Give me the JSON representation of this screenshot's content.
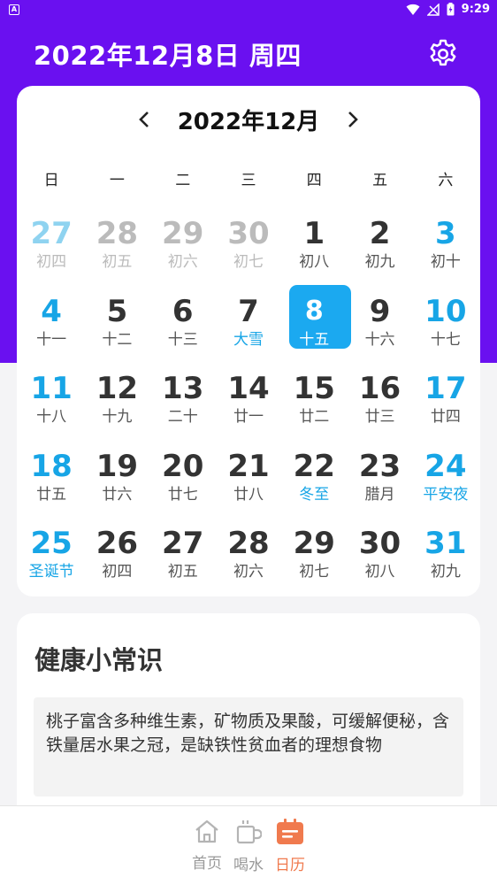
{
  "status_bar": {
    "app_icon": "A",
    "time": "9:29"
  },
  "header": {
    "title": "2022年12月8日 周四",
    "settings_icon": "gear-icon"
  },
  "calendar": {
    "month_title": "2022年12月",
    "weekdays": [
      "日",
      "一",
      "二",
      "三",
      "四",
      "五",
      "六"
    ],
    "days": [
      {
        "num": "27",
        "lunar": "初四",
        "other": true
      },
      {
        "num": "28",
        "lunar": "初五",
        "other": true
      },
      {
        "num": "29",
        "lunar": "初六",
        "other": true
      },
      {
        "num": "30",
        "lunar": "初七",
        "other": true
      },
      {
        "num": "1",
        "lunar": "初八"
      },
      {
        "num": "2",
        "lunar": "初九"
      },
      {
        "num": "3",
        "lunar": "初十"
      },
      {
        "num": "4",
        "lunar": "十一"
      },
      {
        "num": "5",
        "lunar": "十二"
      },
      {
        "num": "6",
        "lunar": "十三"
      },
      {
        "num": "7",
        "lunar": "大雪",
        "festival": true
      },
      {
        "num": "8",
        "lunar": "十五",
        "selected": true
      },
      {
        "num": "9",
        "lunar": "十六"
      },
      {
        "num": "10",
        "lunar": "十七"
      },
      {
        "num": "11",
        "lunar": "十八"
      },
      {
        "num": "12",
        "lunar": "十九"
      },
      {
        "num": "13",
        "lunar": "二十"
      },
      {
        "num": "14",
        "lunar": "廿一"
      },
      {
        "num": "15",
        "lunar": "廿二"
      },
      {
        "num": "16",
        "lunar": "廿三"
      },
      {
        "num": "17",
        "lunar": "廿四"
      },
      {
        "num": "18",
        "lunar": "廿五"
      },
      {
        "num": "19",
        "lunar": "廿六"
      },
      {
        "num": "20",
        "lunar": "廿七"
      },
      {
        "num": "21",
        "lunar": "廿八"
      },
      {
        "num": "22",
        "lunar": "冬至",
        "festival": true
      },
      {
        "num": "23",
        "lunar": "腊月"
      },
      {
        "num": "24",
        "lunar": "平安夜",
        "festival": true
      },
      {
        "num": "25",
        "lunar": "圣诞节",
        "festival": true
      },
      {
        "num": "26",
        "lunar": "初四"
      },
      {
        "num": "27",
        "lunar": "初五"
      },
      {
        "num": "28",
        "lunar": "初六"
      },
      {
        "num": "29",
        "lunar": "初七"
      },
      {
        "num": "30",
        "lunar": "初八"
      },
      {
        "num": "31",
        "lunar": "初九"
      }
    ]
  },
  "health": {
    "title": "健康小常识",
    "tip": "桃子富含多种维生素，矿物质及果酸，可缓解便秘，含铁量居水果之冠，是缺铁性贫血者的理想食物"
  },
  "bottom_nav": [
    {
      "label": "首页",
      "icon": "home-icon"
    },
    {
      "label": "喝水",
      "icon": "cup-icon"
    },
    {
      "label": "日历",
      "icon": "calendar-icon",
      "active": true
    }
  ],
  "colors": {
    "primary": "#6a10f0",
    "accent": "#1ba9f0",
    "nav_active": "#f07a4e"
  }
}
